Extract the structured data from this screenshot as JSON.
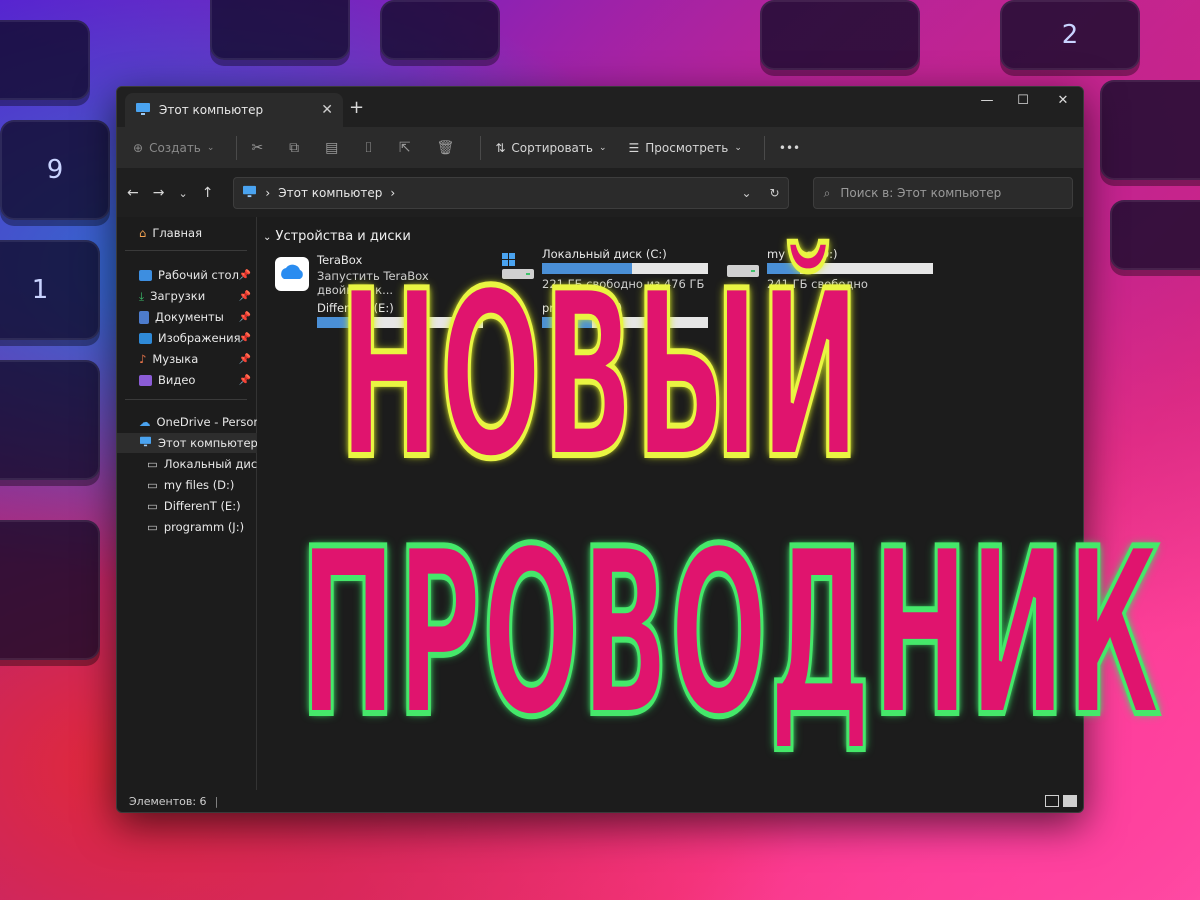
{
  "window": {
    "tab_title": "Этот компьютер",
    "new_tab": "+",
    "controls": [
      "—",
      "☐",
      "✕"
    ]
  },
  "toolbar": {
    "create_label": "Создать",
    "sort_label": "Сортировать",
    "view_label": "Просмотреть",
    "more_label": "•••"
  },
  "address": {
    "path": "Этот компьютер",
    "search_placeholder": "Поиск в: Этот компьютер"
  },
  "sidebar": {
    "home": "Главная",
    "quick": [
      {
        "label": "Рабочий стол",
        "color": "#3d8ee0"
      },
      {
        "label": "Загрузки",
        "color": "#3dbb6a"
      },
      {
        "label": "Документы",
        "color": "#4d7ccc"
      },
      {
        "label": "Изображения",
        "color": "#2f8ad8"
      },
      {
        "label": "Музыка",
        "color": "#e8744a"
      },
      {
        "label": "Видео",
        "color": "#8b5cd6"
      }
    ],
    "onedrive": "OneDrive - Persona",
    "this_pc": "Этот компьютер",
    "drives": [
      "Локальный диск",
      "my files (D:)",
      "DifferenT (E:)",
      "programm (J:)"
    ]
  },
  "content": {
    "group_title": "Устройства и диски",
    "items": [
      {
        "name": "TeraBox",
        "sub": "Запустить TeraBox двойным к...",
        "type": "app"
      },
      {
        "name": "Локальный диск (C:)",
        "sub": "221 ГБ свободно из 476 ГБ",
        "used": 0.54,
        "type": "drive"
      },
      {
        "name": "my files (D:)",
        "sub": "241 ГБ свободно",
        "used": 0.2,
        "type": "drive"
      },
      {
        "name": "DifferenT (E:)",
        "sub": "",
        "used": 0.3,
        "type": "drive"
      },
      {
        "name": "programm (J:)",
        "sub": "",
        "used": 0.3,
        "type": "drive"
      }
    ]
  },
  "status": {
    "count": "Элементов: 6"
  },
  "overlay": {
    "line1": "НОВЫЙ",
    "line2": "ПРОВОДНИК"
  },
  "colors": {
    "accent": "#e0146e",
    "stroke1": "#e9f542",
    "stroke2": "#45e86a",
    "drive_fill": "#4a8fd6"
  }
}
